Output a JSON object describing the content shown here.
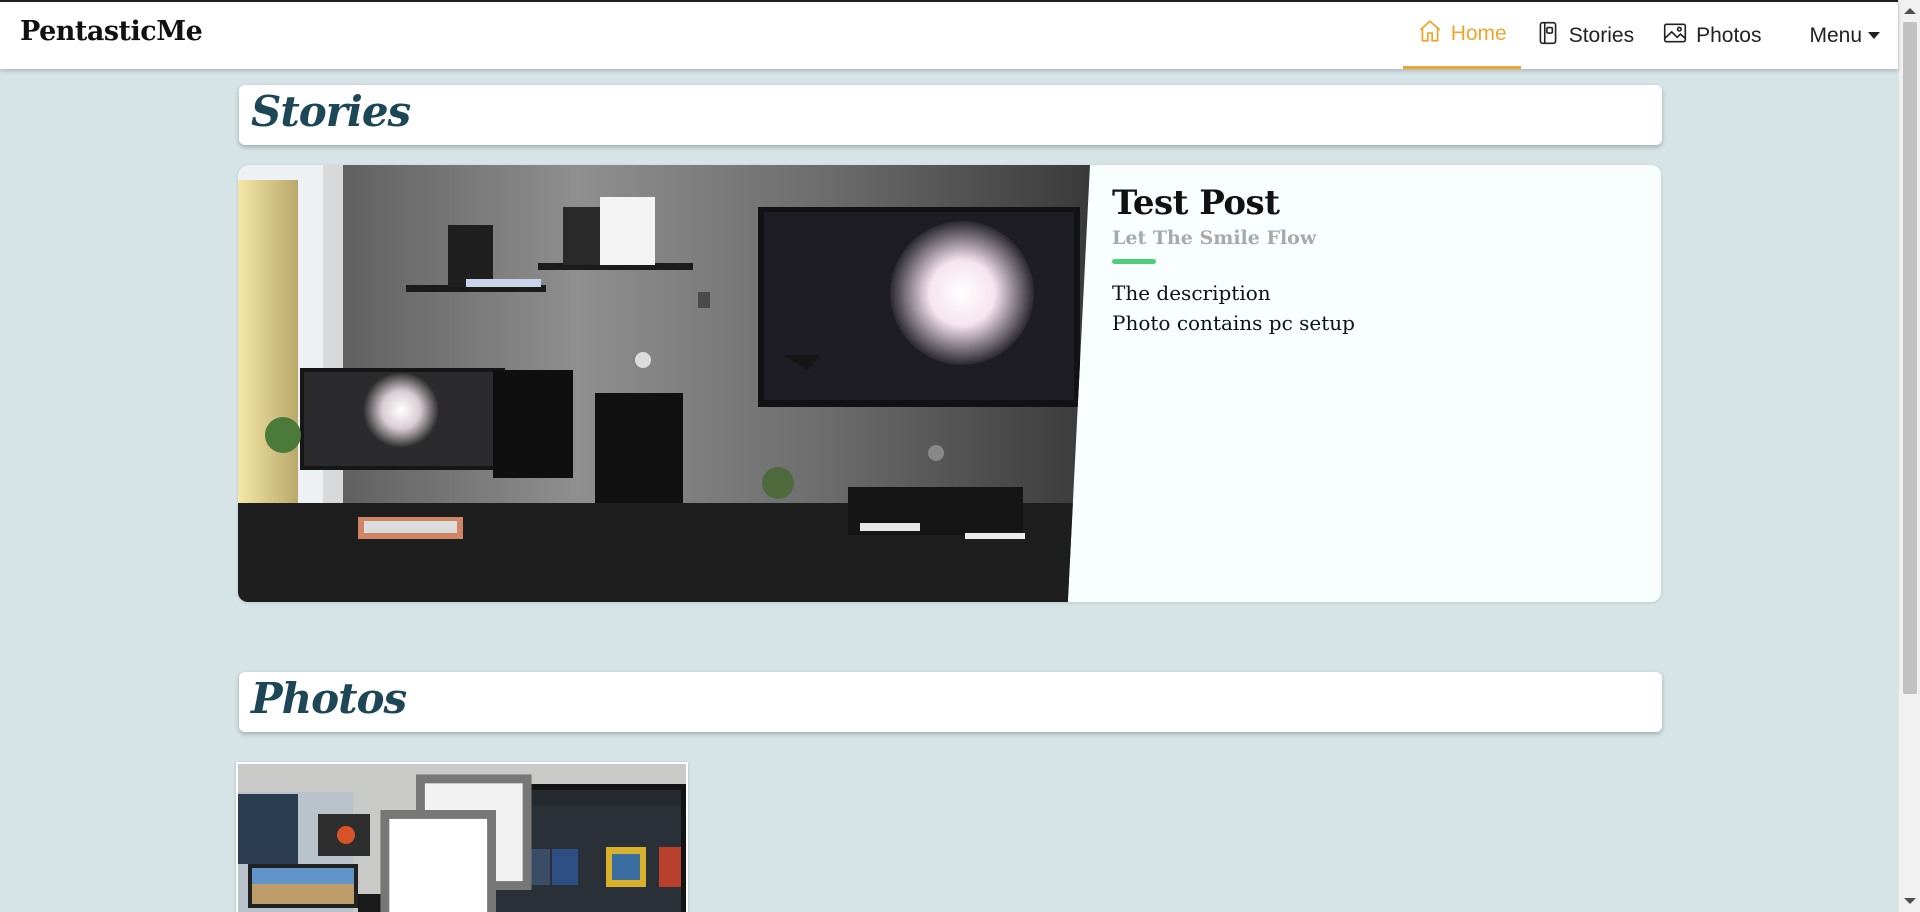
{
  "brand": "PentasticMe",
  "nav": {
    "home": "Home",
    "stories": "Stories",
    "photos": "Photos",
    "menu": "Menu"
  },
  "sections": {
    "stories_title": "Stories",
    "photos_title": "Photos"
  },
  "story": {
    "title": "Test Post",
    "subtitle": "Let The Smile Flow",
    "description_line1": "The description",
    "description_line2": "Photo contains pc setup"
  },
  "colors": {
    "accent_active": "#f0a52d",
    "section_title": "#1d4656",
    "page_background": "#d6e3e7",
    "rule_green": "#4ccf78"
  },
  "icons": {
    "home": "home-icon",
    "stories": "phone-book-icon",
    "photos": "image-icon",
    "menu": "caret-down-icon",
    "photo_badge": "copy-icon"
  }
}
